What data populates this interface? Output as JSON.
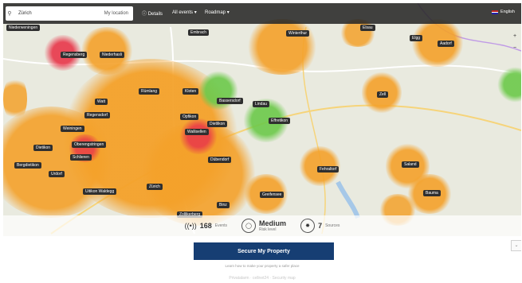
{
  "search": {
    "value": "Zürich",
    "my_location": "My location"
  },
  "menu": {
    "details": "Details",
    "events": "All events",
    "map_type": "Roadmap"
  },
  "language": "English",
  "zoom": {
    "in": "+",
    "out": "−"
  },
  "cities": [
    "Niederweningen",
    "Regensberg",
    "Niederhasli",
    "Embrach",
    "Winterthur",
    "Elsau",
    "Elgg",
    "Aadorf",
    "Watt",
    "Rümlang",
    "Kloten",
    "Bassersdorf",
    "Lindau",
    "Zell",
    "Regensdorf",
    "Opfikon",
    "Dietlikon",
    "Effretikon",
    "Weiningen",
    "Wallisellen",
    "Dietikon",
    "Oberengstringen",
    "Schlieren",
    "Dübendorf",
    "Fehraltorf",
    "Saland",
    "Bergdietikon",
    "Urdorf",
    "Uitikon Waldegg",
    "Zürich",
    "Greifensee",
    "Bauma",
    "Binz",
    "Zollikerberg"
  ],
  "stats": {
    "events_count": "168",
    "events_label": "Events",
    "risk_level": "Medium",
    "risk_label": "Risk level",
    "sources_count": "7",
    "sources_label": "Sources"
  },
  "cta_label": "Secure My Property",
  "subtext": "Learn how to make your property a safer place",
  "logos_text": "Privatalarm · cellnet24 · Security map",
  "colors": {
    "heat_orange": "#f4a12a",
    "heat_red": "#e8364a",
    "heat_green": "#6cc94a",
    "button": "#163e73"
  }
}
